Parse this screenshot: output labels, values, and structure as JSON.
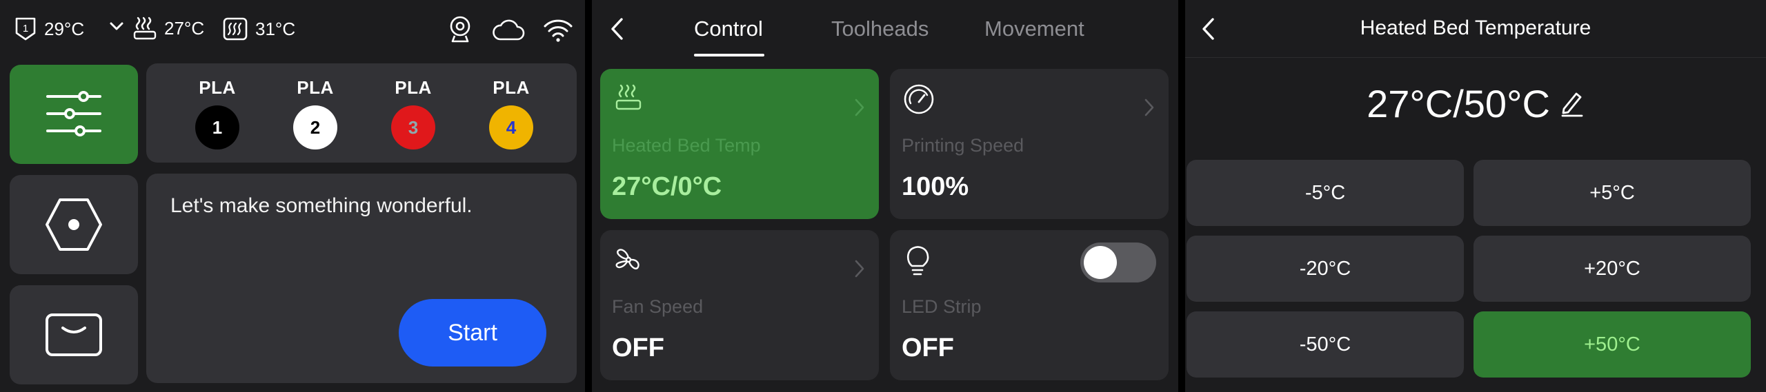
{
  "status": {
    "nozzle_temp": "29°C",
    "bed_temp": "27°C",
    "chamber_temp": "31°C"
  },
  "filaments": [
    {
      "label": "PLA",
      "slot": "1",
      "color": "#000000",
      "text_color": "#ffffff"
    },
    {
      "label": "PLA",
      "slot": "2",
      "color": "#ffffff",
      "text_color": "#000000"
    },
    {
      "label": "PLA",
      "slot": "3",
      "color": "#e0181b",
      "text_color": "#8ea8ad"
    },
    {
      "label": "PLA",
      "slot": "4",
      "color": "#f0b400",
      "text_color": "#2436d1"
    }
  ],
  "home": {
    "message": "Let's make something wonderful.",
    "start_label": "Start"
  },
  "control": {
    "tabs": [
      "Control",
      "Toolheads",
      "Movement"
    ],
    "active_tab": "Control",
    "cards": {
      "bed": {
        "label": "Heated Bed Temp",
        "value": "27°C/0°C"
      },
      "speed": {
        "label": "Printing Speed",
        "value": "100%"
      },
      "fan": {
        "label": "Fan Speed",
        "value": "OFF"
      },
      "led": {
        "label": "LED Strip",
        "value": "OFF",
        "toggle_on": false
      }
    }
  },
  "bed_screen": {
    "title": "Heated Bed Temperature",
    "current": "27°C/50°C",
    "buttons": [
      "-5°C",
      "+5°C",
      "-20°C",
      "+20°C",
      "-50°C",
      "+50°C"
    ],
    "selected": "+50°C"
  },
  "colors": {
    "accent_green": "#2f7d32",
    "start_blue": "#1e5cf5",
    "panel": "#323236",
    "background": "#1c1c1e"
  }
}
